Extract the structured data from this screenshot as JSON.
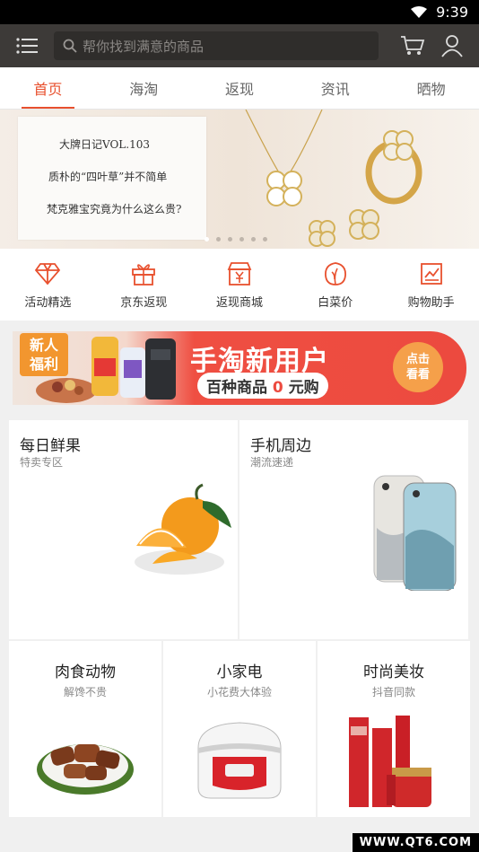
{
  "status": {
    "time": "9:39"
  },
  "search": {
    "placeholder": "帮你找到满意的商品"
  },
  "tabs": [
    {
      "label": "首页",
      "active": true
    },
    {
      "label": "海淘"
    },
    {
      "label": "返现"
    },
    {
      "label": "资讯"
    },
    {
      "label": "晒物"
    }
  ],
  "banner": {
    "line1": "大牌日记VOL.103",
    "line2": "质朴的“四叶草”并不简单",
    "line3": "梵克雅宝究竟为什么这么贵?"
  },
  "quick_nav": [
    {
      "label": "活动精选",
      "icon": "diamond-icon"
    },
    {
      "label": "京东返现",
      "icon": "gift-icon"
    },
    {
      "label": "返现商城",
      "icon": "shop-yen-icon"
    },
    {
      "label": "白菜价",
      "icon": "cabbage-icon"
    },
    {
      "label": "购物助手",
      "icon": "chart-icon"
    }
  ],
  "promo": {
    "badge_line1": "新人",
    "badge_line2": "福利",
    "title": "手淘新用户",
    "sub_prefix": "百种商品",
    "sub_highlight": "0",
    "sub_suffix": "元购",
    "cta_line1": "点击",
    "cta_line2": "看看"
  },
  "categories_top": [
    {
      "title": "每日鲜果",
      "sub": "特卖专区"
    },
    {
      "title": "手机周边",
      "sub": "潮流速递"
    }
  ],
  "categories_bottom": [
    {
      "title": "肉食动物",
      "sub": "解馋不贵"
    },
    {
      "title": "小家电",
      "sub": "小花费大体验"
    },
    {
      "title": "时尚美妆",
      "sub": "抖音同款"
    }
  ],
  "watermark": "WWW.QT6.COM",
  "colors": {
    "accent": "#e8502e",
    "topbar": "#3d3a38"
  }
}
